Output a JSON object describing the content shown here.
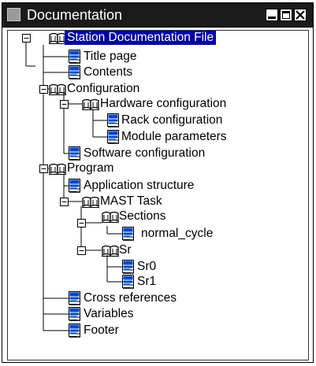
{
  "window": {
    "title": "Documentation"
  },
  "tree": {
    "nodes": [
      {
        "label": "Station Documentation File",
        "type": "book",
        "toggle": "minus",
        "selected": true
      },
      {
        "label": "Title page",
        "type": "page"
      },
      {
        "label": "Contents",
        "type": "page"
      },
      {
        "label": "Configuration",
        "type": "book",
        "toggle": "minus"
      },
      {
        "label": "Hardware configuration",
        "type": "book",
        "toggle": "minus"
      },
      {
        "label": "Rack configuration",
        "type": "page"
      },
      {
        "label": "Module parameters",
        "type": "page"
      },
      {
        "label": "Software configuration",
        "type": "page"
      },
      {
        "label": "Program",
        "type": "book",
        "toggle": "minus"
      },
      {
        "label": "Application structure",
        "type": "page"
      },
      {
        "label": "MAST Task",
        "type": "book",
        "toggle": "minus"
      },
      {
        "label": "Sections",
        "type": "book",
        "toggle": "minus"
      },
      {
        "label": "normal_cycle",
        "type": "page"
      },
      {
        "label": "Sr",
        "type": "book",
        "toggle": "minus"
      },
      {
        "label": "Sr0",
        "type": "page"
      },
      {
        "label": "Sr1",
        "type": "page"
      },
      {
        "label": "Cross references",
        "type": "page"
      },
      {
        "label": "Variables",
        "type": "page"
      },
      {
        "label": "Footer",
        "type": "page"
      }
    ]
  }
}
